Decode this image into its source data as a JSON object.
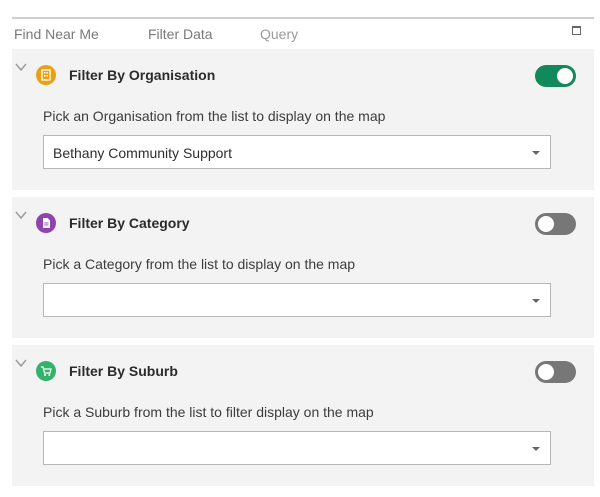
{
  "tabs": [
    {
      "label": "Find Near Me"
    },
    {
      "label": "Filter Data"
    },
    {
      "label": "Query"
    }
  ],
  "filters": [
    {
      "title": "Filter By Organisation",
      "description": "Pick an Organisation from the list to display on the map",
      "selected": "Bethany Community Support",
      "enabled": true,
      "icon": "building-icon",
      "icon_color": "#e8a115"
    },
    {
      "title": "Filter By Category",
      "description": "Pick a Category from the list to display on the map",
      "selected": "",
      "enabled": false,
      "icon": "document-icon",
      "icon_color": "#8e44ad"
    },
    {
      "title": "Filter By Suburb",
      "description": "Pick a Suburb from the list to filter display on the map",
      "selected": "",
      "enabled": false,
      "icon": "cart-icon",
      "icon_color": "#33b26b"
    }
  ],
  "colors": {
    "toggle_on": "#12895a",
    "toggle_off": "#777777",
    "panel_bg": "#f3f3f3"
  }
}
